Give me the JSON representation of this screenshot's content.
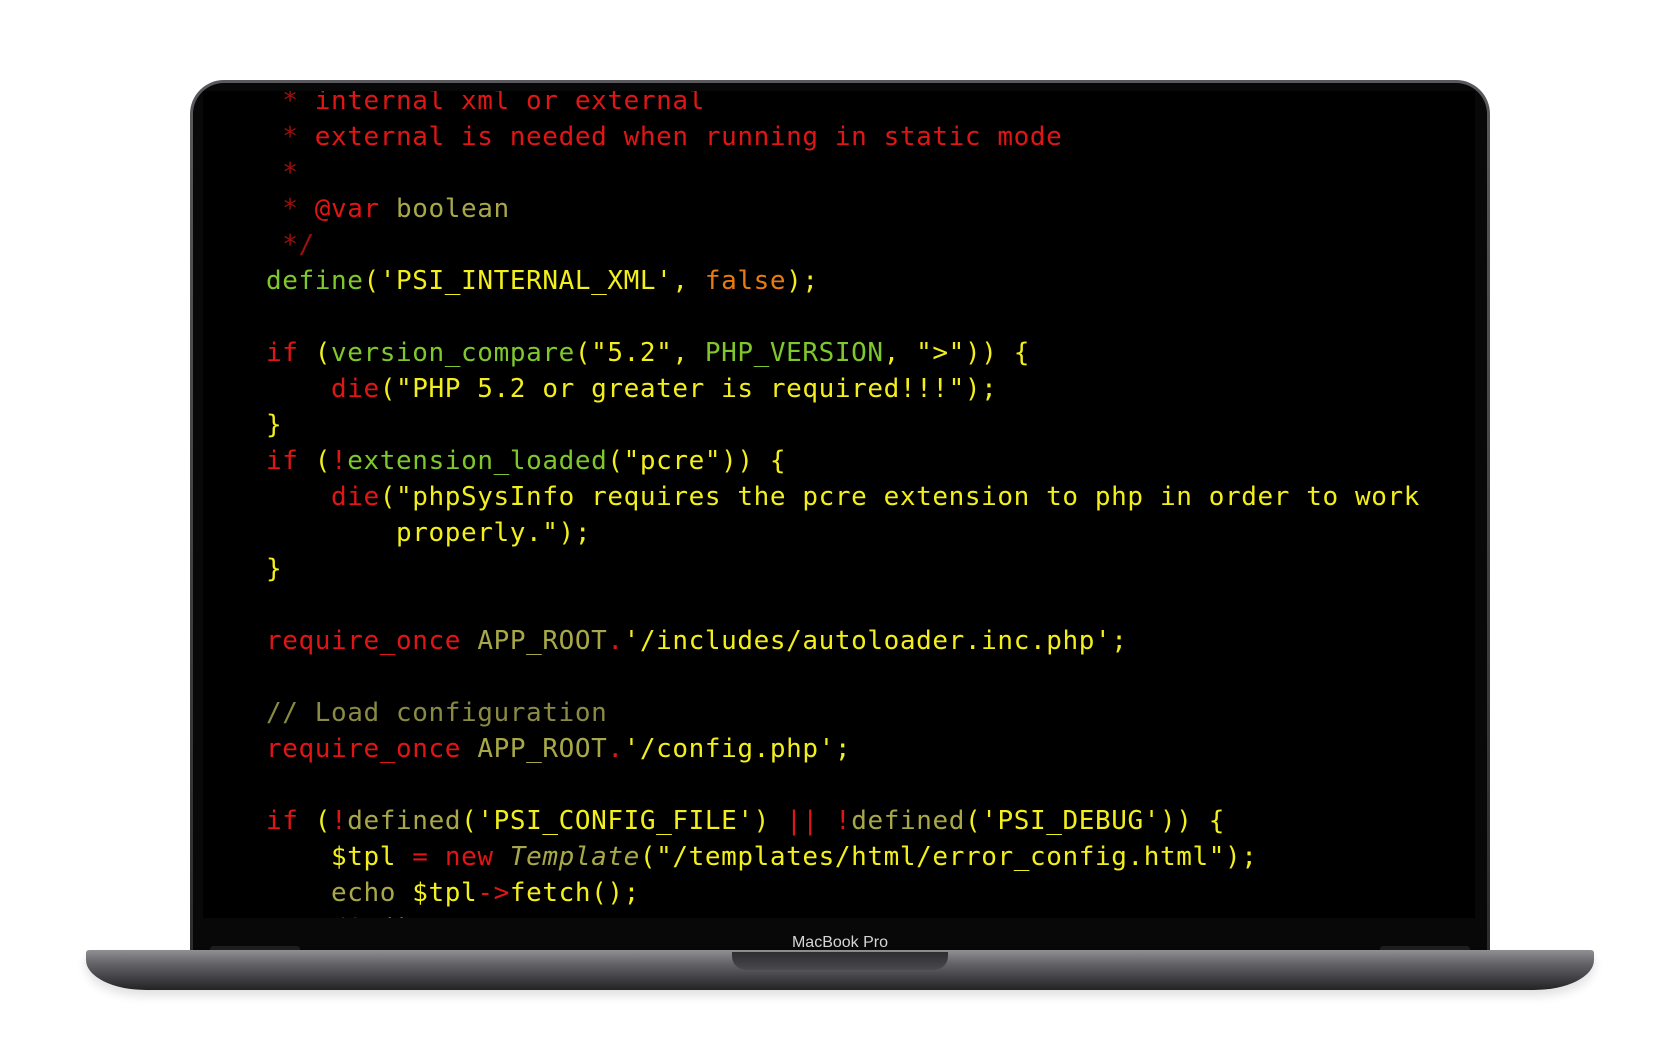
{
  "device": {
    "label": "MacBook Pro"
  },
  "colors": {
    "red": "#e01515",
    "darkred": "#9b1010",
    "orange": "#e87a10",
    "olive": "#a8a84a",
    "green": "#7ec82e",
    "yellow": "#f2ef1c",
    "text": "#f2ef1c",
    "comment": "#8a8a44"
  },
  "code_lines": [
    [
      {
        "t": " * ",
        "c": "darkred"
      },
      {
        "t": "internal xml or external",
        "c": "red"
      }
    ],
    [
      {
        "t": " * ",
        "c": "darkred"
      },
      {
        "t": "external is needed when running in static mode",
        "c": "red"
      }
    ],
    [
      {
        "t": " *",
        "c": "darkred"
      }
    ],
    [
      {
        "t": " * ",
        "c": "darkred"
      },
      {
        "t": "@var",
        "c": "red"
      },
      {
        "t": " boolean",
        "c": "olive"
      }
    ],
    [
      {
        "t": " */",
        "c": "darkred"
      }
    ],
    [
      {
        "t": "define",
        "c": "green"
      },
      {
        "t": "(",
        "c": "text"
      },
      {
        "t": "'PSI_INTERNAL_XML'",
        "c": "yellow"
      },
      {
        "t": ", ",
        "c": "text"
      },
      {
        "t": "false",
        "c": "orange"
      },
      {
        "t": ");",
        "c": "text"
      }
    ],
    [],
    [
      {
        "t": "if",
        "c": "red"
      },
      {
        "t": " (",
        "c": "text"
      },
      {
        "t": "version_compare",
        "c": "green"
      },
      {
        "t": "(\"5.2\", ",
        "c": "yellow"
      },
      {
        "t": "PHP_VERSION",
        "c": "green"
      },
      {
        "t": ", \">\")) {",
        "c": "yellow"
      }
    ],
    [
      {
        "t": "    ",
        "c": "text"
      },
      {
        "t": "die",
        "c": "red"
      },
      {
        "t": "(\"PHP 5.2 or greater is required!!!\");",
        "c": "yellow"
      }
    ],
    [
      {
        "t": "}",
        "c": "yellow"
      }
    ],
    [
      {
        "t": "if",
        "c": "red"
      },
      {
        "t": " (",
        "c": "text"
      },
      {
        "t": "!",
        "c": "red"
      },
      {
        "t": "extension_loaded",
        "c": "green"
      },
      {
        "t": "(\"pcre\")) {",
        "c": "yellow"
      }
    ],
    [
      {
        "t": "    ",
        "c": "text"
      },
      {
        "t": "die",
        "c": "red"
      },
      {
        "t": "(\"phpSysInfo requires the pcre extension to php in order to work",
        "c": "yellow"
      }
    ],
    [
      {
        "t": "        properly.\");",
        "c": "yellow"
      }
    ],
    [
      {
        "t": "}",
        "c": "yellow"
      }
    ],
    [],
    [
      {
        "t": "require_once",
        "c": "red"
      },
      {
        "t": " ",
        "c": "text"
      },
      {
        "t": "APP_ROOT",
        "c": "olive"
      },
      {
        "t": ".",
        "c": "red"
      },
      {
        "t": "'/includes/autoloader.inc.php';",
        "c": "yellow"
      }
    ],
    [],
    [
      {
        "t": "// Load configuration",
        "c": "comment"
      }
    ],
    [
      {
        "t": "require_once",
        "c": "red"
      },
      {
        "t": " ",
        "c": "text"
      },
      {
        "t": "APP_ROOT",
        "c": "olive"
      },
      {
        "t": ".",
        "c": "red"
      },
      {
        "t": "'/config.php';",
        "c": "yellow"
      }
    ],
    [],
    [
      {
        "t": "if",
        "c": "red"
      },
      {
        "t": " (",
        "c": "text"
      },
      {
        "t": "!",
        "c": "red"
      },
      {
        "t": "defined",
        "c": "olive"
      },
      {
        "t": "('PSI_CONFIG_FILE') ",
        "c": "yellow"
      },
      {
        "t": "||",
        "c": "red"
      },
      {
        "t": " ",
        "c": "text"
      },
      {
        "t": "!",
        "c": "red"
      },
      {
        "t": "defined",
        "c": "olive"
      },
      {
        "t": "('PSI_DEBUG')) {",
        "c": "yellow"
      }
    ],
    [
      {
        "t": "    $tpl ",
        "c": "yellow"
      },
      {
        "t": "=",
        "c": "red"
      },
      {
        "t": " ",
        "c": "text"
      },
      {
        "t": "new",
        "c": "red"
      },
      {
        "t": " ",
        "c": "text"
      },
      {
        "t": "Template",
        "c": "olive",
        "i": true
      },
      {
        "t": "(\"/templates/html/error_config.html\");",
        "c": "yellow"
      }
    ],
    [
      {
        "t": "    ",
        "c": "text"
      },
      {
        "t": "echo",
        "c": "olive"
      },
      {
        "t": " $tpl",
        "c": "yellow"
      },
      {
        "t": "->",
        "c": "red"
      },
      {
        "t": "fetch();",
        "c": "yellow"
      }
    ],
    [
      {
        "t": "    ",
        "c": "text"
      },
      {
        "t": "die",
        "c": "red"
      },
      {
        "t": "();",
        "c": "yellow"
      }
    ]
  ]
}
